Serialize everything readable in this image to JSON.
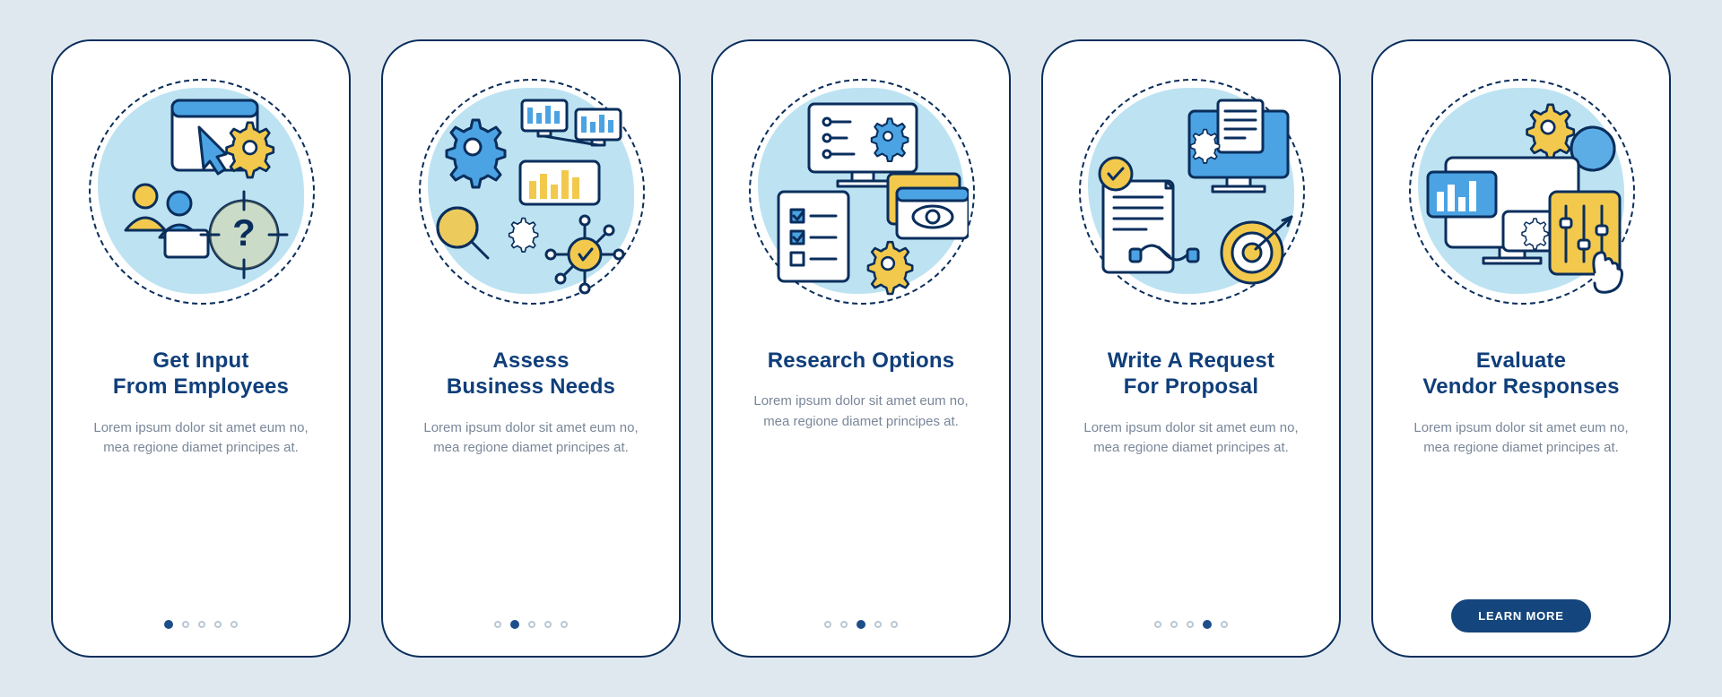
{
  "body_text": "Lorem ipsum dolor sit amet eum no, mea regione diamet principes at.",
  "cta_label": "LEARN MORE",
  "cards": [
    {
      "title": "Get Input\nFrom Employees",
      "icon_name": "input-from-employees-icon"
    },
    {
      "title": "Assess\nBusiness Needs",
      "icon_name": "assess-business-needs-icon"
    },
    {
      "title": "Research Options",
      "icon_name": "research-options-icon"
    },
    {
      "title": "Write A Request\nFor Proposal",
      "icon_name": "write-rfp-icon"
    },
    {
      "title": "Evaluate\nVendor Responses",
      "icon_name": "evaluate-responses-icon"
    }
  ],
  "total_steps": 5
}
